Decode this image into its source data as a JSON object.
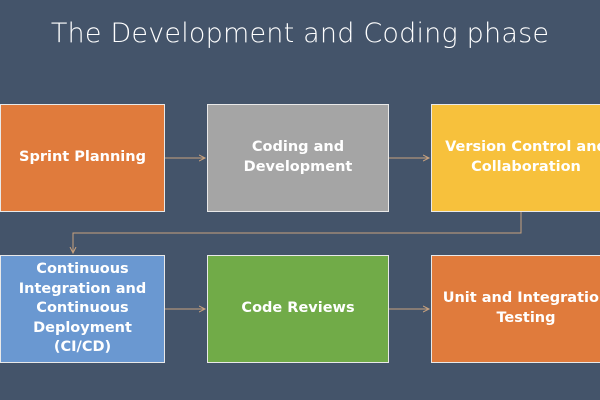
{
  "title": "The Development and Coding phase",
  "steps": [
    {
      "label": "Sprint Planning"
    },
    {
      "label": "Coding and\nDevelopment"
    },
    {
      "label": "Version Control and\nCollaboration"
    },
    {
      "label": "Continuous\nIntegration and\nContinuous\nDeployment (CI/CD)"
    },
    {
      "label": "Code Reviews"
    },
    {
      "label": "Unit and Integration\nTesting"
    }
  ],
  "colors": {
    "background": "#44546a",
    "orange": "#e07b3c",
    "gray": "#a5a5a5",
    "yellow": "#f7c13c",
    "blue": "#6a98d1",
    "green": "#71ab48",
    "connector": "#c9a27e"
  }
}
